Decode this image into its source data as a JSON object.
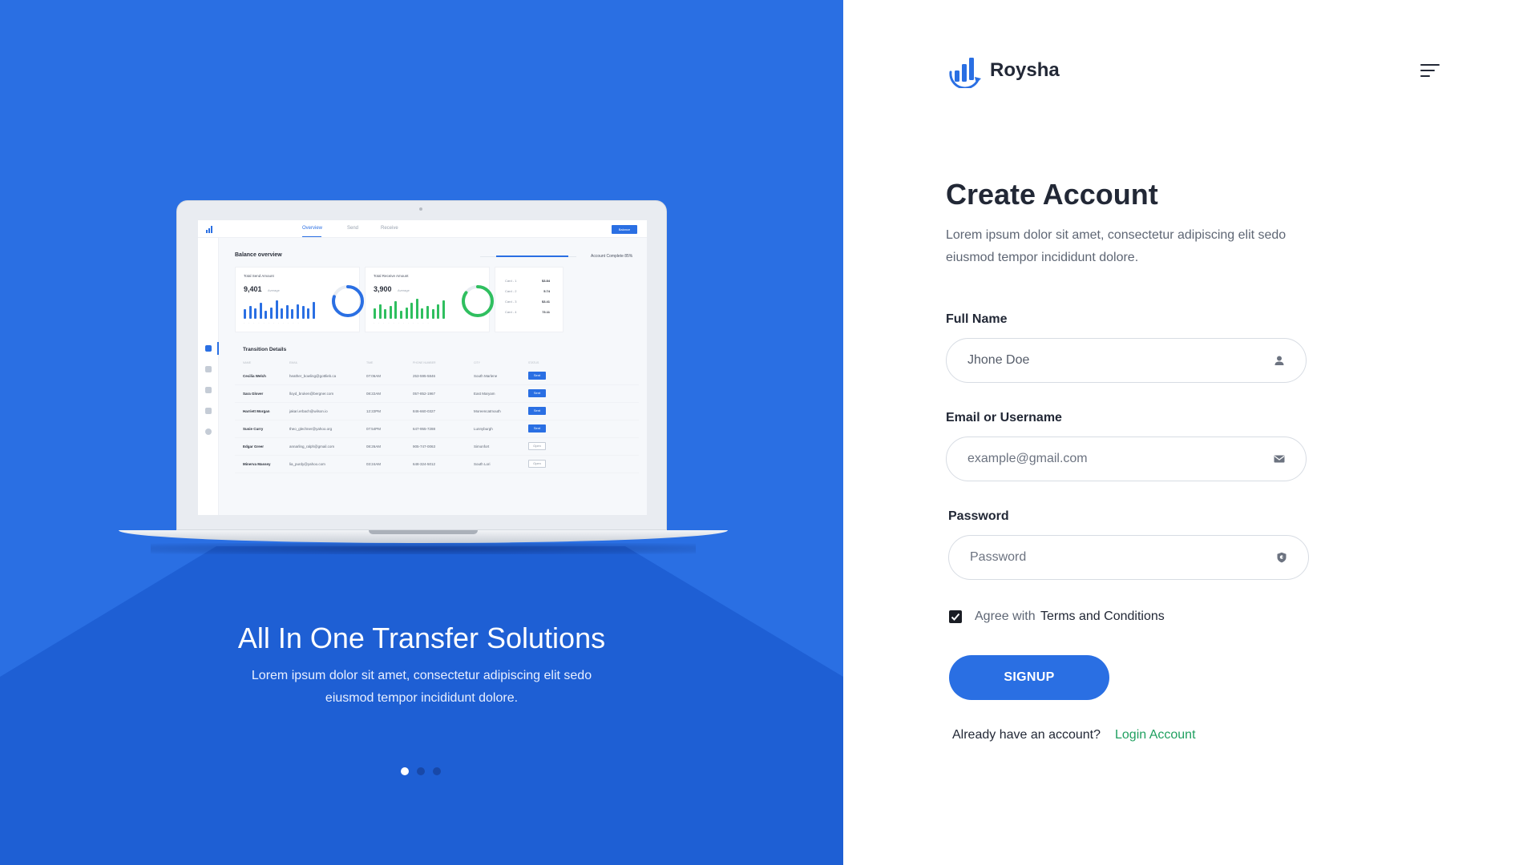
{
  "hero": {
    "title": "All In One Transfer Solutions",
    "subtitle": "Lorem ipsum dolor sit amet, consectetur adipiscing elit sedo eiusmod tempor incididunt dolore.",
    "carousel": {
      "slides": 3,
      "active_index": 0
    }
  },
  "dashboard_preview": {
    "tabs": [
      "Overview",
      "Send",
      "Receive"
    ],
    "active_tab": "Overview",
    "button": "Balance",
    "title": "Balance overview",
    "progress_label": "Account Complete 85%",
    "cards": [
      {
        "title": "Total Send Amount",
        "value": "9,401",
        "avg": "Average"
      },
      {
        "title": "Total Receive Amount",
        "value": "3,900",
        "avg": "Average"
      }
    ],
    "card_list": [
      {
        "label": "Card - 1",
        "value": "$3.84"
      },
      {
        "label": "Card - 2",
        "value": "5.74"
      },
      {
        "label": "Card - 3",
        "value": "$3.41"
      },
      {
        "label": "Card - 4",
        "value": "73.11"
      }
    ],
    "table_title": "Transition Details",
    "table_headers": [
      "NAME",
      "EMAIL",
      "TIME",
      "PHONE NUMBER",
      "CITY",
      "STATUS"
    ],
    "rows": [
      {
        "name": "Cecilia Welch",
        "email": "heather_bowling@gottlieb.ca",
        "time": "07:06AM",
        "phone": "253-595-5846",
        "city": "South Marlene",
        "status": "Sent"
      },
      {
        "name": "Sara Glover",
        "email": "lloyd_bruken@bergner.com",
        "time": "08:22AM",
        "phone": "057-852-1967",
        "city": "East Maryam",
        "status": "Sent"
      },
      {
        "name": "Harriett Morgan",
        "email": "jakari.erbach@wilson.io",
        "time": "12:22PM",
        "phone": "846-660-0327",
        "city": "Moreencatmouth",
        "status": "Sent"
      },
      {
        "name": "Susie Curry",
        "email": "theo_glechner@yahoo.org",
        "time": "07:54PM",
        "phone": "647-955-7288",
        "city": "Lunnyburgh",
        "status": "Sent"
      },
      {
        "name": "Edgar Greer",
        "email": "annarling_ralph@gmail.com",
        "time": "08:26AM",
        "phone": "905-747-0063",
        "city": "Simonfort",
        "status": "Open"
      },
      {
        "name": "Minerva Massey",
        "email": "lia_purdy@yahoo.com",
        "time": "03:24AM",
        "phone": "648-324-5012",
        "city": "South Lori",
        "status": "Open"
      }
    ],
    "send_bars": [
      0.45,
      0.6,
      0.5,
      0.75,
      0.4,
      0.55,
      0.9,
      0.5,
      0.65,
      0.45,
      0.7,
      0.6,
      0.5,
      0.8
    ],
    "receive_bars": [
      0.5,
      0.7,
      0.45,
      0.6,
      0.85,
      0.4,
      0.55,
      0.75,
      0.95,
      0.5,
      0.6,
      0.45,
      0.7,
      0.9
    ],
    "send_ring_pct": 0.8,
    "receive_ring_pct": 0.85,
    "colors": {
      "blue": "#2a6fe3",
      "green": "#2fbf5f"
    }
  },
  "brand": {
    "name": "Roysha"
  },
  "form": {
    "title": "Create Account",
    "subtitle": "Lorem ipsum dolor sit amet, consectetur adipiscing elit sedo eiusmod tempor incididunt dolore.",
    "full_name": {
      "label": "Full Name",
      "value": "Jhone Doe",
      "icon": "user-icon"
    },
    "email": {
      "label": "Email or Username",
      "placeholder": "example@gmail.com",
      "icon": "mail-icon"
    },
    "password": {
      "label": "Password",
      "placeholder": "Password",
      "icon": "shield-icon"
    },
    "agree": {
      "checked": true,
      "text": "Agree with",
      "link": "Terms and Conditions"
    },
    "signup": "SIGNUP",
    "already": "Already have an account?",
    "login": "Login Account"
  },
  "colors": {
    "primary": "#2a6fe3",
    "link_green": "#20a060",
    "text_dark": "#222836"
  }
}
